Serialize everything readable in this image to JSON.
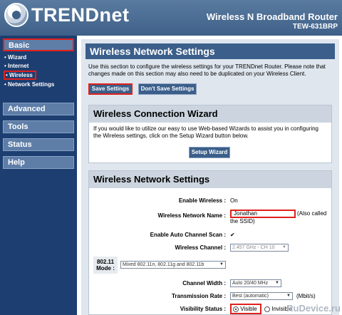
{
  "header": {
    "brand": "TRENDnet",
    "product": "Wireless N Broadband Router",
    "model": "TEW-631BRP"
  },
  "sidebar": {
    "basic": "Basic",
    "sub_items": [
      "Wizard",
      "Internet",
      "Wireless",
      "Network Settings"
    ],
    "sections": [
      "Advanced",
      "Tools",
      "Status",
      "Help"
    ]
  },
  "page": {
    "title": "Wireless Network Settings",
    "intro": "Use this section to configure the wireless settings for your TRENDnet Router. Please note that changes made on this section may also need to be duplicated on your Wireless Client.",
    "save_label": "Save Settings",
    "dont_save_label": "Don't Save Settings"
  },
  "wizard": {
    "title": "Wireless Connection Wizard",
    "text": "If you would like to utilize our easy to use Web-based Wizards to assist you in configuring the Wireless settings, click on the Setup Wizard button below.",
    "button": "Setup Wizard"
  },
  "settings": {
    "title": "Wireless Network Settings",
    "enable_wireless_label": "Enable Wireless :",
    "enable_wireless_value": "On",
    "ssid_label": "Wireless Network Name :",
    "ssid_value": "Jonathan",
    "ssid_note": "(Also called the SSID)",
    "auto_channel_label": "Enable Auto Channel Scan :",
    "auto_channel_value": "✔",
    "channel_label": "Wireless Channel :",
    "channel_value": "2.457 GHz - CH 10",
    "mode_label": "802.11 Mode :",
    "mode_value": "Mixed 802.11n, 802.11g and 802.11b",
    "width_label": "Channel Width :",
    "width_value": "Auto 20/40 MHz",
    "rate_label": "Transmission Rate :",
    "rate_value": "Best (automatic)",
    "rate_unit": "(Mbit/s)",
    "visibility_label": "Visibility Status :",
    "visible_label": "Visible",
    "invisible_label": "Invisible"
  },
  "watermark": "RuDevice.ru"
}
